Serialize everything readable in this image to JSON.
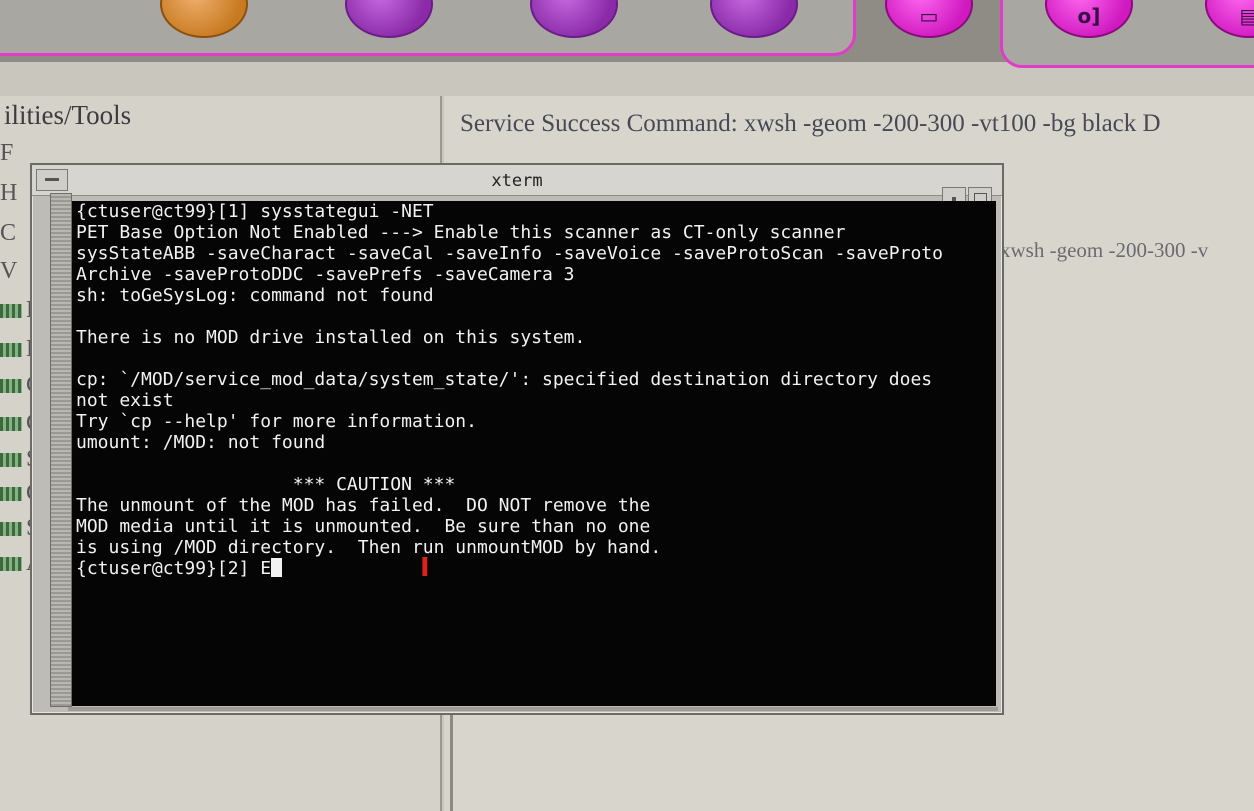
{
  "launcher": {
    "buttons": [
      {
        "glyph": "",
        "color": "orange"
      },
      {
        "glyph": "",
        "color": "purple"
      },
      {
        "glyph": "",
        "color": "purple"
      },
      {
        "glyph": "",
        "color": "purple"
      },
      {
        "glyph": "▭",
        "color": "pink"
      },
      {
        "glyph": "o]",
        "color": "pink"
      },
      {
        "glyph": "▤",
        "color": "pink"
      }
    ]
  },
  "left_panel": {
    "title": "ilities/Tools",
    "rows": [
      "F",
      "H",
      "C",
      "V",
      "E",
      "E",
      "C",
      "C",
      "S",
      "C",
      "S",
      "A"
    ]
  },
  "right_panel": {
    "service_command": "Service Success Command: xwsh -geom -200-300 -vt100 -bg black D",
    "service_command_2": "xwsh -geom -200-300 -v"
  },
  "xterm": {
    "title": "xterm",
    "lines": [
      "{ctuser@ct99}[1] sysstategui -NET",
      "PET Base Option Not Enabled ---> Enable this scanner as CT-only scanner",
      "sysStateABB -saveCharact -saveCal -saveInfo -saveVoice -saveProtoScan -saveProto",
      "Archive -saveProtoDDC -savePrefs -saveCamera 3",
      "sh: toGeSysLog: command not found",
      "",
      "There is no MOD drive installed on this system.",
      "",
      "cp: `/MOD/service_mod_data/system_state/': specified destination directory does",
      "not exist",
      "Try `cp --help' for more information.",
      "umount: /MOD: not found",
      "",
      "                    *** CAUTION ***",
      "The unmount of the MOD has failed.  DO NOT remove the",
      "MOD media until it is unmounted.  Be sure than no one",
      "is using /MOD directory.  Then run unmountMOD by hand."
    ],
    "prompt": "{ctuser@ct99}[2] E"
  },
  "colors": {
    "accent_pink": "#e03cc8",
    "terminal_bg": "#050505",
    "terminal_fg": "#f2f2f2",
    "ibeam": "#e0201a"
  }
}
